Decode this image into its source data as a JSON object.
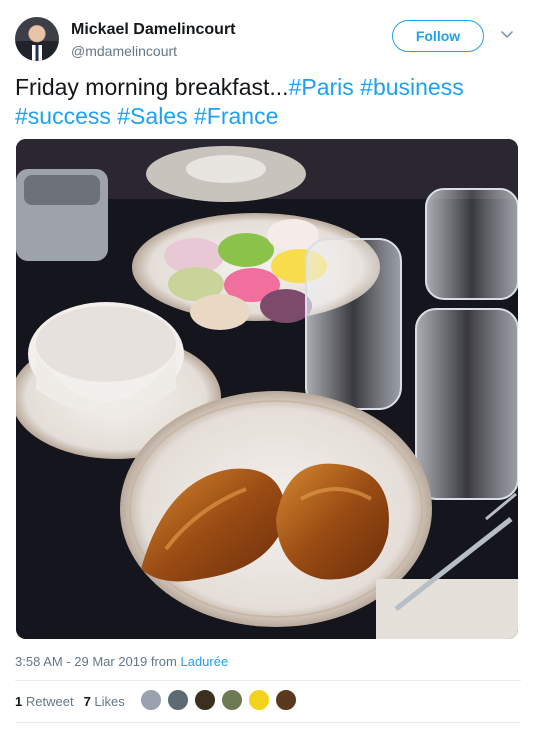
{
  "user": {
    "name": "Mickael Damelincourt",
    "handle": "@mdamelincourt"
  },
  "follow_label": "Follow",
  "tweet": {
    "text": "Friday morning breakfast...",
    "hashtags": [
      "#Paris",
      "#business",
      "#success",
      "#Sales",
      "#France"
    ]
  },
  "meta": {
    "time": "3:58 AM - 29 Mar 2019 from",
    "source": "Ladurée"
  },
  "stats": {
    "retweets_count": "1",
    "retweets_label": "Retweet",
    "likes_count": "7",
    "likes_label": "Likes"
  },
  "likers": [
    {
      "color": "#9aa3ad"
    },
    {
      "color": "#5d6a73"
    },
    {
      "color": "#3d2f1f"
    },
    {
      "color": "#6e7b52"
    },
    {
      "color": "#f2d21b"
    },
    {
      "color": "#5a3a1f"
    }
  ],
  "colors": {
    "accent": "#1da1f2",
    "text": "#14171a",
    "muted": "#657786"
  }
}
